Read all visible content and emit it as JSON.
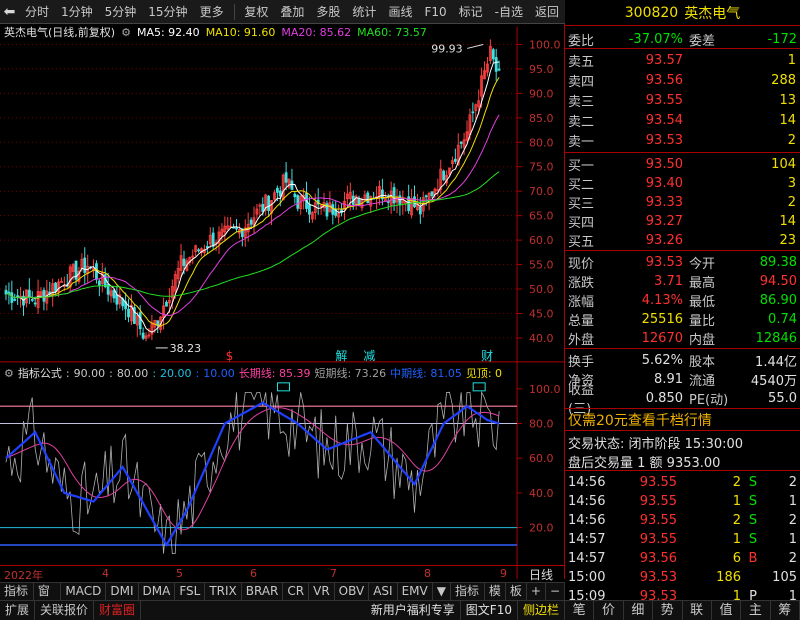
{
  "toolbar": {
    "items": [
      "分时",
      "1分钟",
      "5分钟",
      "15分钟",
      "更多",
      "复权",
      "叠加",
      "多股",
      "统计",
      "画线",
      "F10",
      "标记",
      "-自选",
      "返回"
    ]
  },
  "chart": {
    "title": "英杰电气(日线,前复权)",
    "ma_labels": [
      {
        "text": "MA5: 92.40",
        "color": "#ffffff"
      },
      {
        "text": "MA10: 91.60",
        "color": "#f0e000"
      },
      {
        "text": "MA20: 85.62",
        "color": "#e040e0"
      },
      {
        "text": "MA60: 73.57",
        "color": "#20e020"
      }
    ],
    "y_ticks": [
      "100.0",
      "95.0",
      "90.0",
      "85.0",
      "80.0",
      "75.0",
      "70.0",
      "65.0",
      "60.0",
      "55.0",
      "50.0",
      "45.0",
      "40.0"
    ],
    "high_label": "99.93",
    "low_label": "38.23",
    "event_marks": [
      "$",
      "解",
      "减",
      "财"
    ]
  },
  "indicator": {
    "name": "指标公式",
    "values": [
      "90.00",
      "80.00",
      "20.00",
      "10.00"
    ],
    "long_line": "长期线: 85.39",
    "short_line": "短期线: 73.26",
    "mid_line": "中期线: 81.05",
    "top_see": "见顶: 0",
    "y_ticks": [
      "100.0",
      "80.0",
      "60.0",
      "40.0",
      "20.0"
    ]
  },
  "x_axis": {
    "labels": [
      "2022年",
      "4",
      "5",
      "6",
      "7",
      "8",
      "9"
    ],
    "period": "日线"
  },
  "bottom_tabs1": [
    "指标A",
    "窗口",
    "MACD",
    "DMI",
    "DMA",
    "FSL",
    "TRIX",
    "BRAR",
    "CR",
    "VR",
    "OBV",
    "ASI",
    "EMV",
    "▼",
    "指标B",
    "模",
    "板",
    "+",
    "−"
  ],
  "bottom_tabs2": {
    "items": [
      "扩展",
      "关联报价",
      "财富圈"
    ],
    "right_items": [
      "新用户福利专享",
      "图文F10",
      "侧边栏"
    ]
  },
  "quote": {
    "code": "300820",
    "name": "英杰电气",
    "weibi_label": "委比",
    "weibi": "-37.07%",
    "weicha_label": "委差",
    "weicha": "-172",
    "sells": [
      {
        "label": "卖五",
        "price": "93.57",
        "vol": "1"
      },
      {
        "label": "卖四",
        "price": "93.56",
        "vol": "288"
      },
      {
        "label": "卖三",
        "price": "93.55",
        "vol": "13"
      },
      {
        "label": "卖二",
        "price": "93.54",
        "vol": "14"
      },
      {
        "label": "卖一",
        "price": "93.53",
        "vol": "2"
      }
    ],
    "buys": [
      {
        "label": "买一",
        "price": "93.50",
        "vol": "104"
      },
      {
        "label": "买二",
        "price": "93.40",
        "vol": "3"
      },
      {
        "label": "买三",
        "price": "93.33",
        "vol": "2"
      },
      {
        "label": "买四",
        "price": "93.27",
        "vol": "14"
      },
      {
        "label": "买五",
        "price": "93.26",
        "vol": "23"
      }
    ],
    "stats": [
      {
        "l1": "现价",
        "v1": "93.53",
        "c1": "red",
        "l2": "今开",
        "v2": "89.38",
        "c2": "green"
      },
      {
        "l1": "涨跌",
        "v1": "3.71",
        "c1": "red",
        "l2": "最高",
        "v2": "94.50",
        "c2": "red"
      },
      {
        "l1": "涨幅",
        "v1": "4.13%",
        "c1": "red",
        "l2": "最低",
        "v2": "86.90",
        "c2": "green"
      },
      {
        "l1": "总量",
        "v1": "25516",
        "c1": "yellow",
        "l2": "量比",
        "v2": "0.74",
        "c2": "green"
      },
      {
        "l1": "外盘",
        "v1": "12670",
        "c1": "red",
        "l2": "内盘",
        "v2": "12846",
        "c2": "green"
      }
    ],
    "stats2": [
      {
        "l1": "换手",
        "v1": "5.62%",
        "l2": "股本",
        "v2": "1.44亿"
      },
      {
        "l1": "净资",
        "v1": "8.91",
        "l2": "流通",
        "v2": "4540万"
      },
      {
        "l1": "收益(三)",
        "v1": "0.850",
        "l2": "PE(动)",
        "v2": "55.0"
      }
    ],
    "promo": "仅需20元查看千档行情",
    "trade_status": "交易状态: 闭市阶段 15:30:00",
    "after_hours": "盘后交易量 1 额 9353.00",
    "ticks": [
      {
        "time": "14:56",
        "price": "93.55",
        "vol": "2",
        "bs": "S",
        "n": "2"
      },
      {
        "time": "14:56",
        "price": "93.55",
        "vol": "1",
        "bs": "S",
        "n": "1"
      },
      {
        "time": "14:56",
        "price": "93.55",
        "vol": "2",
        "bs": "S",
        "n": "2"
      },
      {
        "time": "14:57",
        "price": "93.55",
        "vol": "1",
        "bs": "S",
        "n": "1"
      },
      {
        "time": "14:57",
        "price": "93.56",
        "vol": "6",
        "bs": "B",
        "n": "2"
      },
      {
        "time": "15:00",
        "price": "93.53",
        "vol": "186",
        "bs": "",
        "n": "105"
      },
      {
        "time": "15:09",
        "price": "93.53",
        "vol": "1",
        "bs": "P",
        "n": "1"
      }
    ],
    "tabs": [
      "笔",
      "价",
      "细",
      "势",
      "联",
      "值",
      "主",
      "筹"
    ]
  }
}
